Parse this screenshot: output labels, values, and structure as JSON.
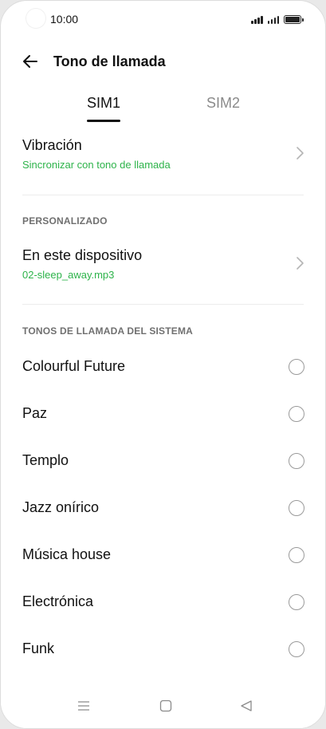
{
  "status_bar": {
    "time": "10:00"
  },
  "header": {
    "title": "Tono de llamada",
    "back_icon": "arrow-left-icon"
  },
  "tabs": [
    {
      "label": "SIM1",
      "selected": true
    },
    {
      "label": "SIM2",
      "selected": false
    }
  ],
  "vibration": {
    "title": "Vibración",
    "subtitle": "Sincronizar con tono de llamada"
  },
  "custom_section": {
    "header": "PERSONALIZADO",
    "item": {
      "title": "En este dispositivo",
      "subtitle": "02-sleep_away.mp3"
    }
  },
  "system_section": {
    "header": "TONOS DE LLAMADA DEL SISTEMA",
    "items": [
      {
        "label": "Colourful Future"
      },
      {
        "label": "Paz"
      },
      {
        "label": "Templo"
      },
      {
        "label": "Jazz onírico"
      },
      {
        "label": "Música house"
      },
      {
        "label": "Electrónica"
      },
      {
        "label": "Funk"
      }
    ]
  },
  "colors": {
    "accent_green": "#2db34a",
    "text_primary": "#111111",
    "text_secondary": "#8a8a8a"
  }
}
